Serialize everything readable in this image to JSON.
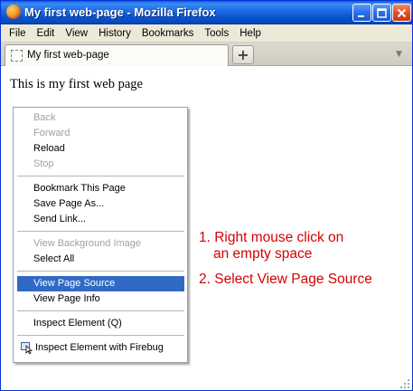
{
  "window": {
    "title": "My first web-page - Mozilla Firefox",
    "controls": {
      "minimize": "_",
      "maximize": "□",
      "close": "✕"
    }
  },
  "menubar": {
    "items": [
      "File",
      "Edit",
      "View",
      "History",
      "Bookmarks",
      "Tools",
      "Help"
    ]
  },
  "tabs": {
    "active_label": "My first web-page",
    "new_tab_label": "+",
    "dropdown_label": "▼"
  },
  "page": {
    "body_text": "This is my first web page"
  },
  "context_menu": {
    "items": [
      {
        "label": "Back",
        "disabled": true
      },
      {
        "label": "Forward",
        "disabled": true
      },
      {
        "label": "Reload",
        "disabled": false
      },
      {
        "label": "Stop",
        "disabled": true
      },
      {
        "label": "Bookmark This Page",
        "disabled": false
      },
      {
        "label": "Save Page As...",
        "disabled": false
      },
      {
        "label": "Send Link...",
        "disabled": false
      },
      {
        "label": "View Background Image",
        "disabled": true
      },
      {
        "label": "Select All",
        "disabled": false
      },
      {
        "label": "View Page Source",
        "disabled": false,
        "selected": true
      },
      {
        "label": "View Page Info",
        "disabled": false
      },
      {
        "label": "Inspect Element (Q)",
        "disabled": false
      },
      {
        "label": "Inspect Element with Firebug",
        "disabled": false,
        "icon": "firebug-inspect-icon"
      }
    ]
  },
  "annotations": {
    "step1_line1": "1. Right mouse click on",
    "step1_line2": "an empty space",
    "step2": "2. Select View Page Source"
  },
  "colors": {
    "titlebar": "#0a55d0",
    "selection": "#316ac5",
    "annotation": "#d60000"
  }
}
